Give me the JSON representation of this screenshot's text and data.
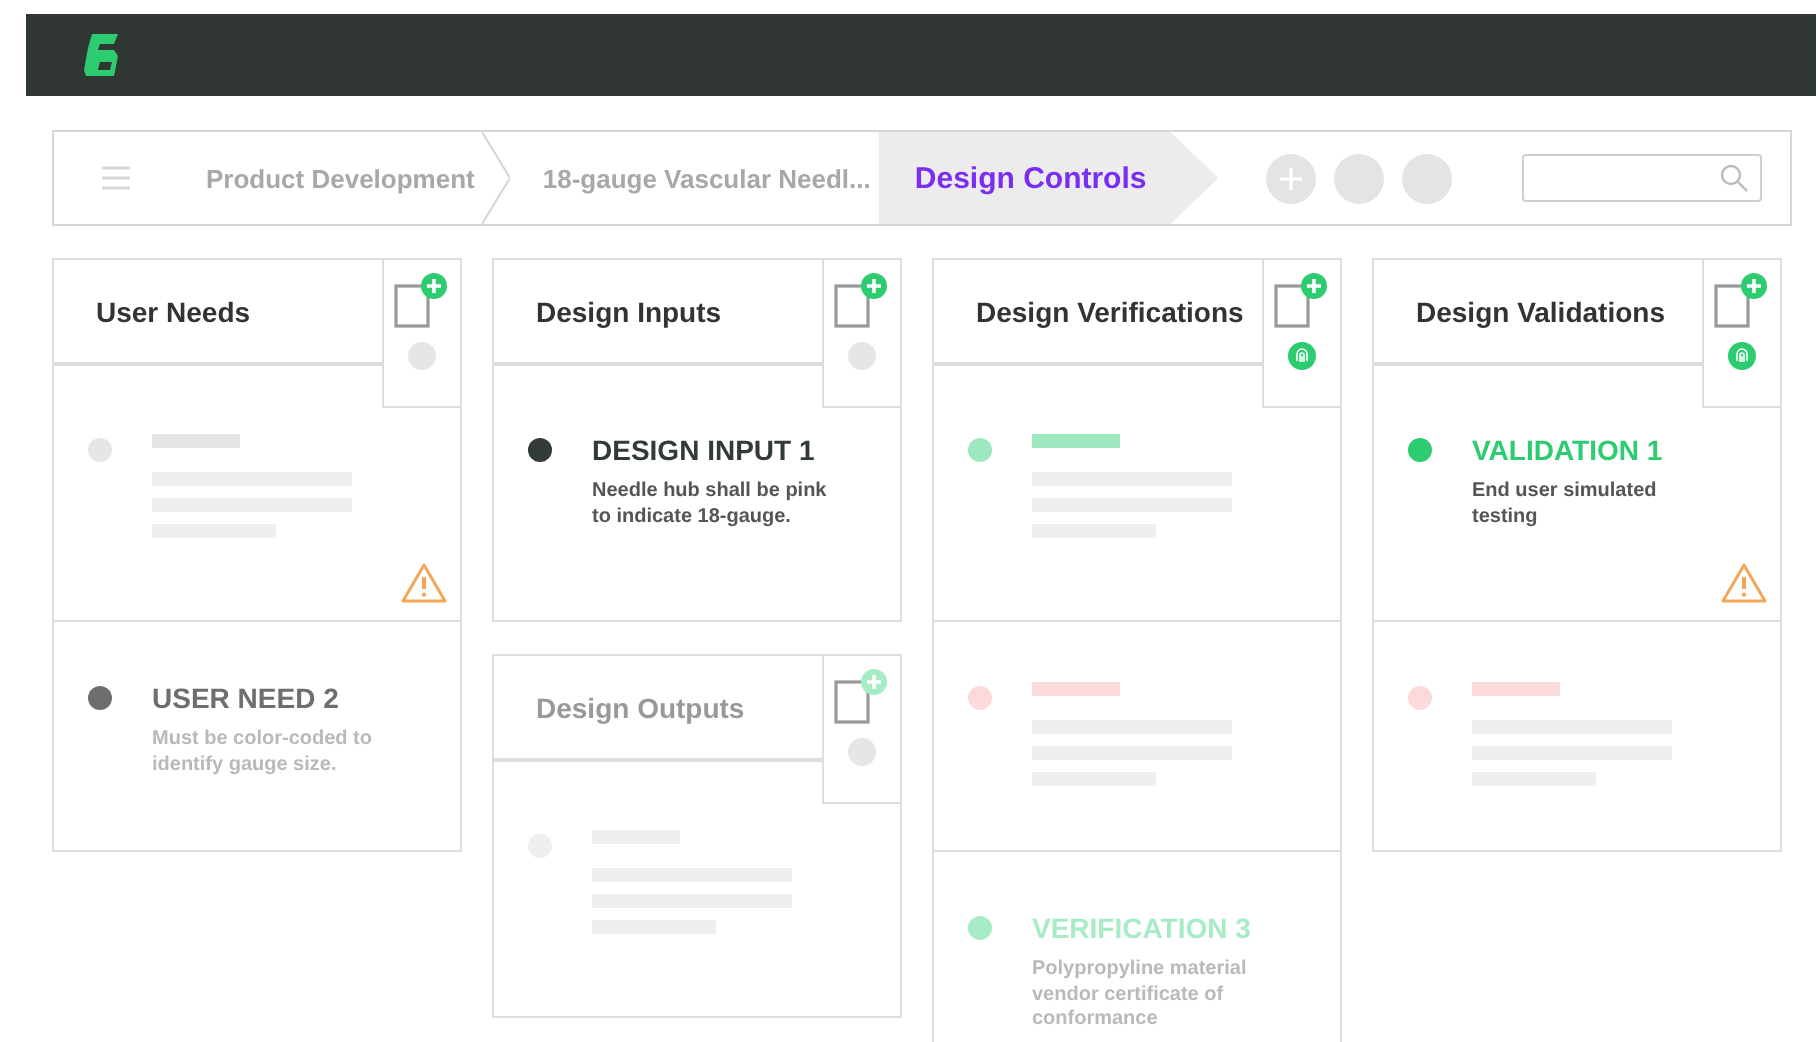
{
  "breadcrumb": {
    "items": [
      {
        "label": "Product Development",
        "selected": false
      },
      {
        "label": "18-gauge Vascular Needl...",
        "selected": false
      },
      {
        "label": "Design Controls",
        "selected": true
      }
    ]
  },
  "columns": [
    {
      "panels": [
        {
          "title": "User Needs",
          "faded": false,
          "locked": false,
          "cards": [
            {
              "kind": "skeleton",
              "color": "#e6e6e6",
              "warning": true
            },
            {
              "kind": "item",
              "title": "USER NEED 2",
              "text": "Must be color-coded to identify gauge size.",
              "color": "#6e6e6e",
              "faded": true,
              "warning": false
            }
          ]
        }
      ]
    },
    {
      "panels": [
        {
          "title": "Design Inputs",
          "faded": false,
          "locked": false,
          "cards": [
            {
              "kind": "item",
              "title": "DESIGN INPUT 1",
              "text": "Needle hub shall be pink to indicate 18-gauge.",
              "color": "#333b38",
              "faded": false,
              "warning": false
            }
          ]
        },
        {
          "title": "Design Outputs",
          "faded": true,
          "locked": false,
          "cards": [
            {
              "kind": "skeleton",
              "color": "#efefef",
              "warning": false
            }
          ]
        }
      ]
    },
    {
      "panels": [
        {
          "title": "Design Verifications",
          "faded": false,
          "locked": true,
          "cards": [
            {
              "kind": "skeleton",
              "color": "#9ee8bf",
              "warning": false
            },
            {
              "kind": "skeleton",
              "color": "#fadadb",
              "warning": false
            },
            {
              "kind": "item",
              "title": "VERIFICATION 3",
              "text": "Polypropyline material vendor certificate of conformance",
              "color": "#a8ecc6",
              "faded": true,
              "warning": false
            }
          ]
        }
      ]
    },
    {
      "panels": [
        {
          "title": "Design Validations",
          "faded": false,
          "locked": true,
          "cards": [
            {
              "kind": "item",
              "title": "VALIDATION 1",
              "text": "End user simulated testing",
              "color": "#2ecc71",
              "faded": false,
              "warning": true
            },
            {
              "kind": "skeleton",
              "color": "#fadadb",
              "warning": false
            }
          ]
        }
      ]
    }
  ]
}
